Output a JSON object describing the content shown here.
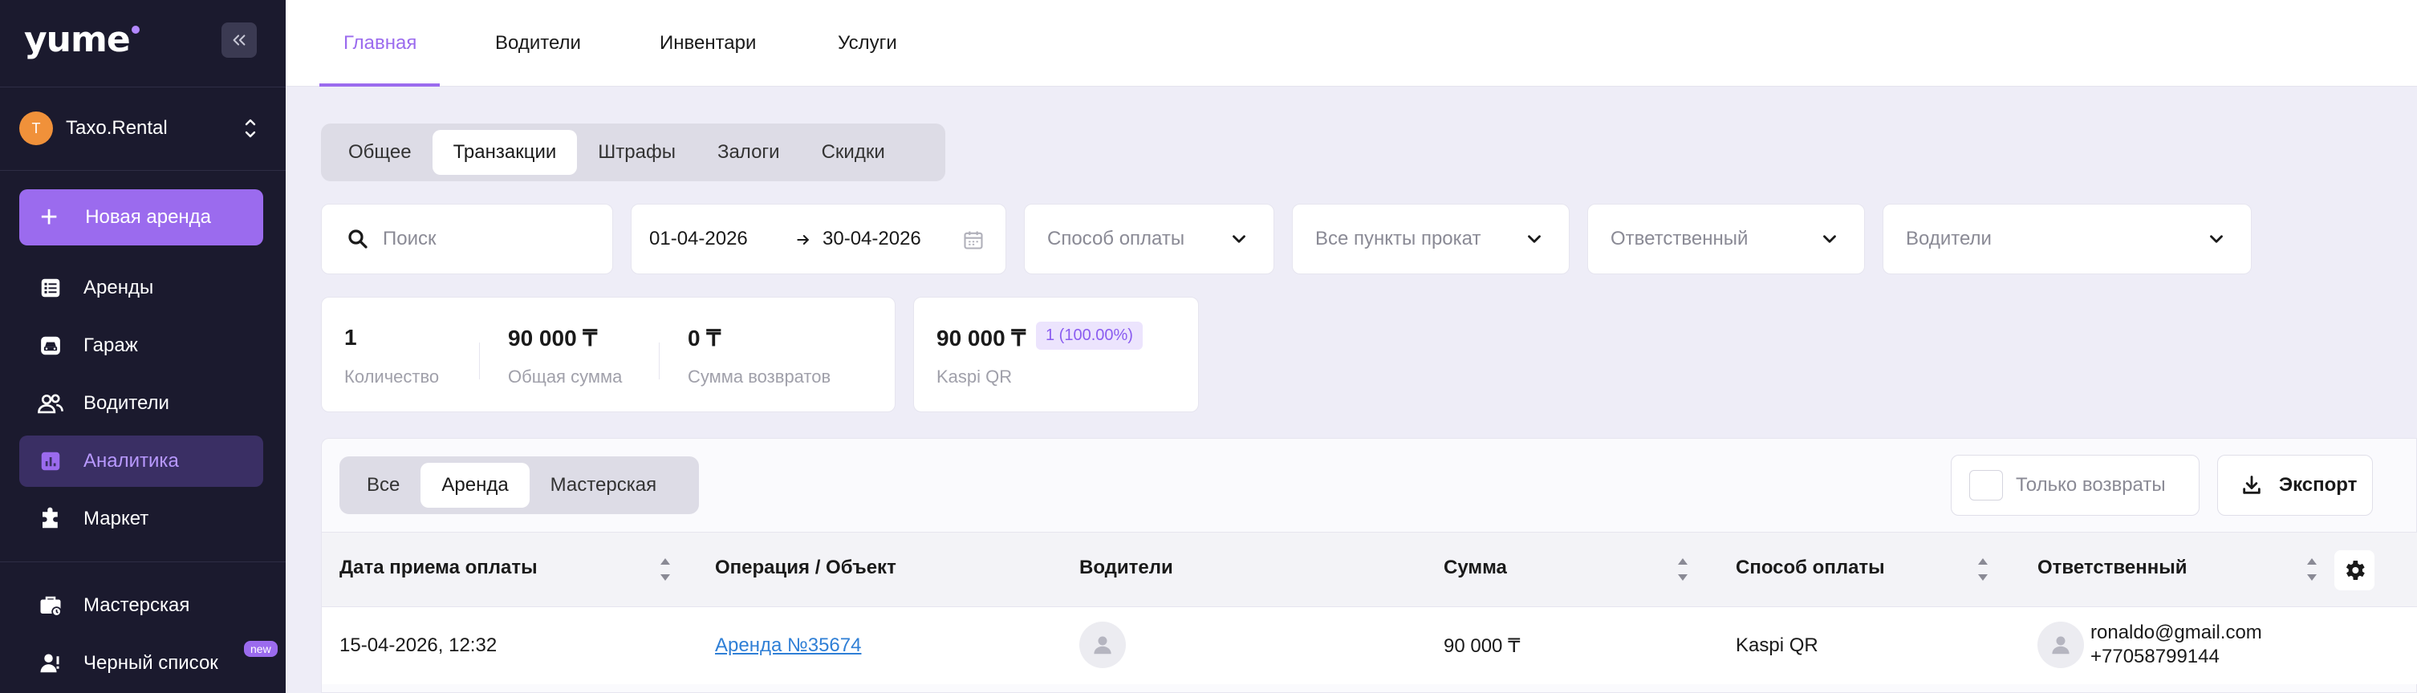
{
  "app": {
    "logo": "yume"
  },
  "company": {
    "initial": "T",
    "name": "Taxo.Rental"
  },
  "sidebar": {
    "new_rent_label": "Новая аренда",
    "items": [
      {
        "label": "Аренды",
        "icon": "list-icon"
      },
      {
        "label": "Гараж",
        "icon": "car-icon"
      },
      {
        "label": "Водители",
        "icon": "users-icon"
      },
      {
        "label": "Аналитика",
        "icon": "analytics-icon",
        "active": true
      },
      {
        "label": "Маркет",
        "icon": "puzzle-icon"
      },
      {
        "label": "Мастерская",
        "icon": "toolbox-icon"
      },
      {
        "label": "Черный список",
        "icon": "blacklist-icon",
        "badge": "new"
      }
    ]
  },
  "top_tabs": [
    "Главная",
    "Водители",
    "Инвентари",
    "Услуги"
  ],
  "section_tabs": [
    "Общее",
    "Транзакции",
    "Штрафы",
    "Залоги",
    "Скидки"
  ],
  "filters": {
    "search_placeholder": "Поиск",
    "date_from": "01-04-2026",
    "date_to": "30-04-2026",
    "payment_method_placeholder": "Способ оплаты",
    "points_placeholder": "Все пункты прокат",
    "responsible_placeholder": "Ответственный",
    "drivers_placeholder": "Водители"
  },
  "stats": {
    "count_value": "1",
    "count_label": "Количество",
    "total_value": "90 000 ₸",
    "total_label": "Общая сумма",
    "refunds_value": "0 ₸",
    "refunds_label": "Сумма возвратов"
  },
  "method_card": {
    "value": "90 000 ₸",
    "badge": "1 (100.00%)",
    "label": "Kaspi QR"
  },
  "table_tabs": [
    "Все",
    "Аренда",
    "Мастерская"
  ],
  "toolbar": {
    "refunds_only_label": "Только возвраты",
    "export_label": "Экспорт"
  },
  "table": {
    "columns": [
      "Дата приема оплаты",
      "Операция / Объект",
      "Водители",
      "Сумма",
      "Способ оплаты",
      "Ответственный"
    ],
    "rows": [
      {
        "date": "15-04-2026, 12:32",
        "operation": "Аренда №35674",
        "amount": "90 000 ₸",
        "method": "Kaspi QR",
        "responsible_email": "ronaldo@gmail.com",
        "responsible_phone": "+77058799144"
      }
    ]
  },
  "colors": {
    "accent": "#9b6bee",
    "sidebar_bg": "#1b1a2e",
    "page_bg": "#eeedf7",
    "link": "#2f7fd6"
  }
}
